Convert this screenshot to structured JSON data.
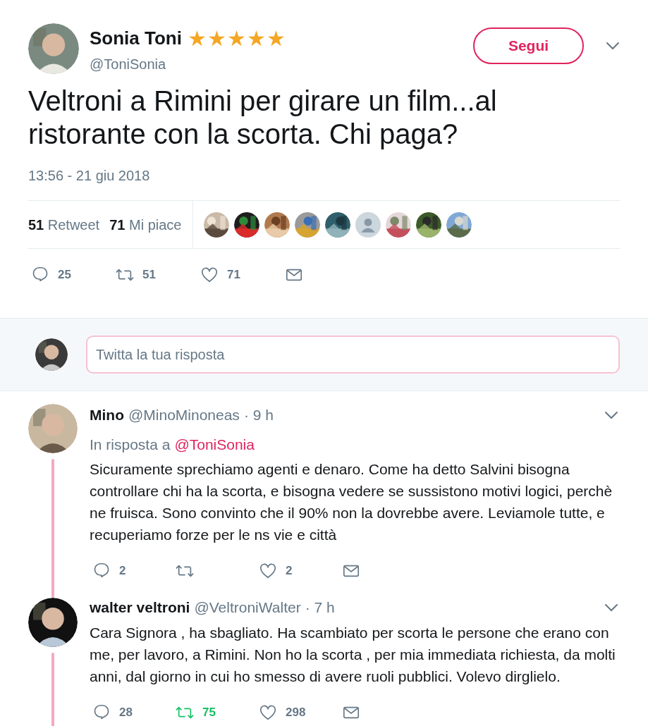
{
  "tweet": {
    "name": "Sonia Toni",
    "name_emoji": "★★★★★",
    "handle": "@ToniSonia",
    "follow_button": "Segui",
    "text": "Veltroni a Rimini per girare un film...al ristorante con la scorta. Chi paga?",
    "timestamp": "13:56 - 21 giu 2018",
    "stats": [
      {
        "count": "51",
        "label": "Retweet"
      },
      {
        "count": "71",
        "label": "Mi piace"
      }
    ],
    "likers": [
      {
        "kind": "picture"
      },
      {
        "kind": "picture"
      },
      {
        "kind": "picture"
      },
      {
        "kind": "picture"
      },
      {
        "kind": "picture"
      },
      {
        "kind": "default"
      },
      {
        "kind": "picture"
      },
      {
        "kind": "picture"
      },
      {
        "kind": "picture"
      }
    ],
    "actions": {
      "replies": "25",
      "retweets": "51",
      "likes": "71",
      "retweeted": false,
      "liked": false
    }
  },
  "reply_box": {
    "placeholder": "Twitta la tua risposta"
  },
  "replies": [
    {
      "name": "Mino",
      "handle": "@MinoMinoneas",
      "time": "· 9 h",
      "in_reply_prefix": "In risposta a",
      "in_reply_to": "@ToniSonia",
      "text": "Sicuramente sprechiamo agenti e denaro. Come ha detto Salvini bisogna controllare chi ha la scorta, e bisogna vedere se sussistono motivi logici, perchè ne fruisca. Sono convinto che il 90% non la dovrebbe avere. Leviamole tutte, e recuperiamo forze per le ns vie e città",
      "actions": {
        "replies": "2",
        "likes": "2",
        "retweeted": false,
        "liked": false
      }
    },
    {
      "name": "walter veltroni",
      "handle": "@VeltroniWalter",
      "time": "· 7 h",
      "text": "Cara Signora , ha sbagliato. Ha scambiato per scorta le persone che erano con me, per lavoro, a Rimini. Non ho la scorta , per mia immediata richiesta, da molti anni, dal giorno in cui ho smesso di avere ruoli pubblici. Volevo dirglielo.",
      "actions": {
        "replies": "28",
        "retweets": "75",
        "likes": "298",
        "retweeted": true,
        "liked": false
      }
    }
  ]
}
